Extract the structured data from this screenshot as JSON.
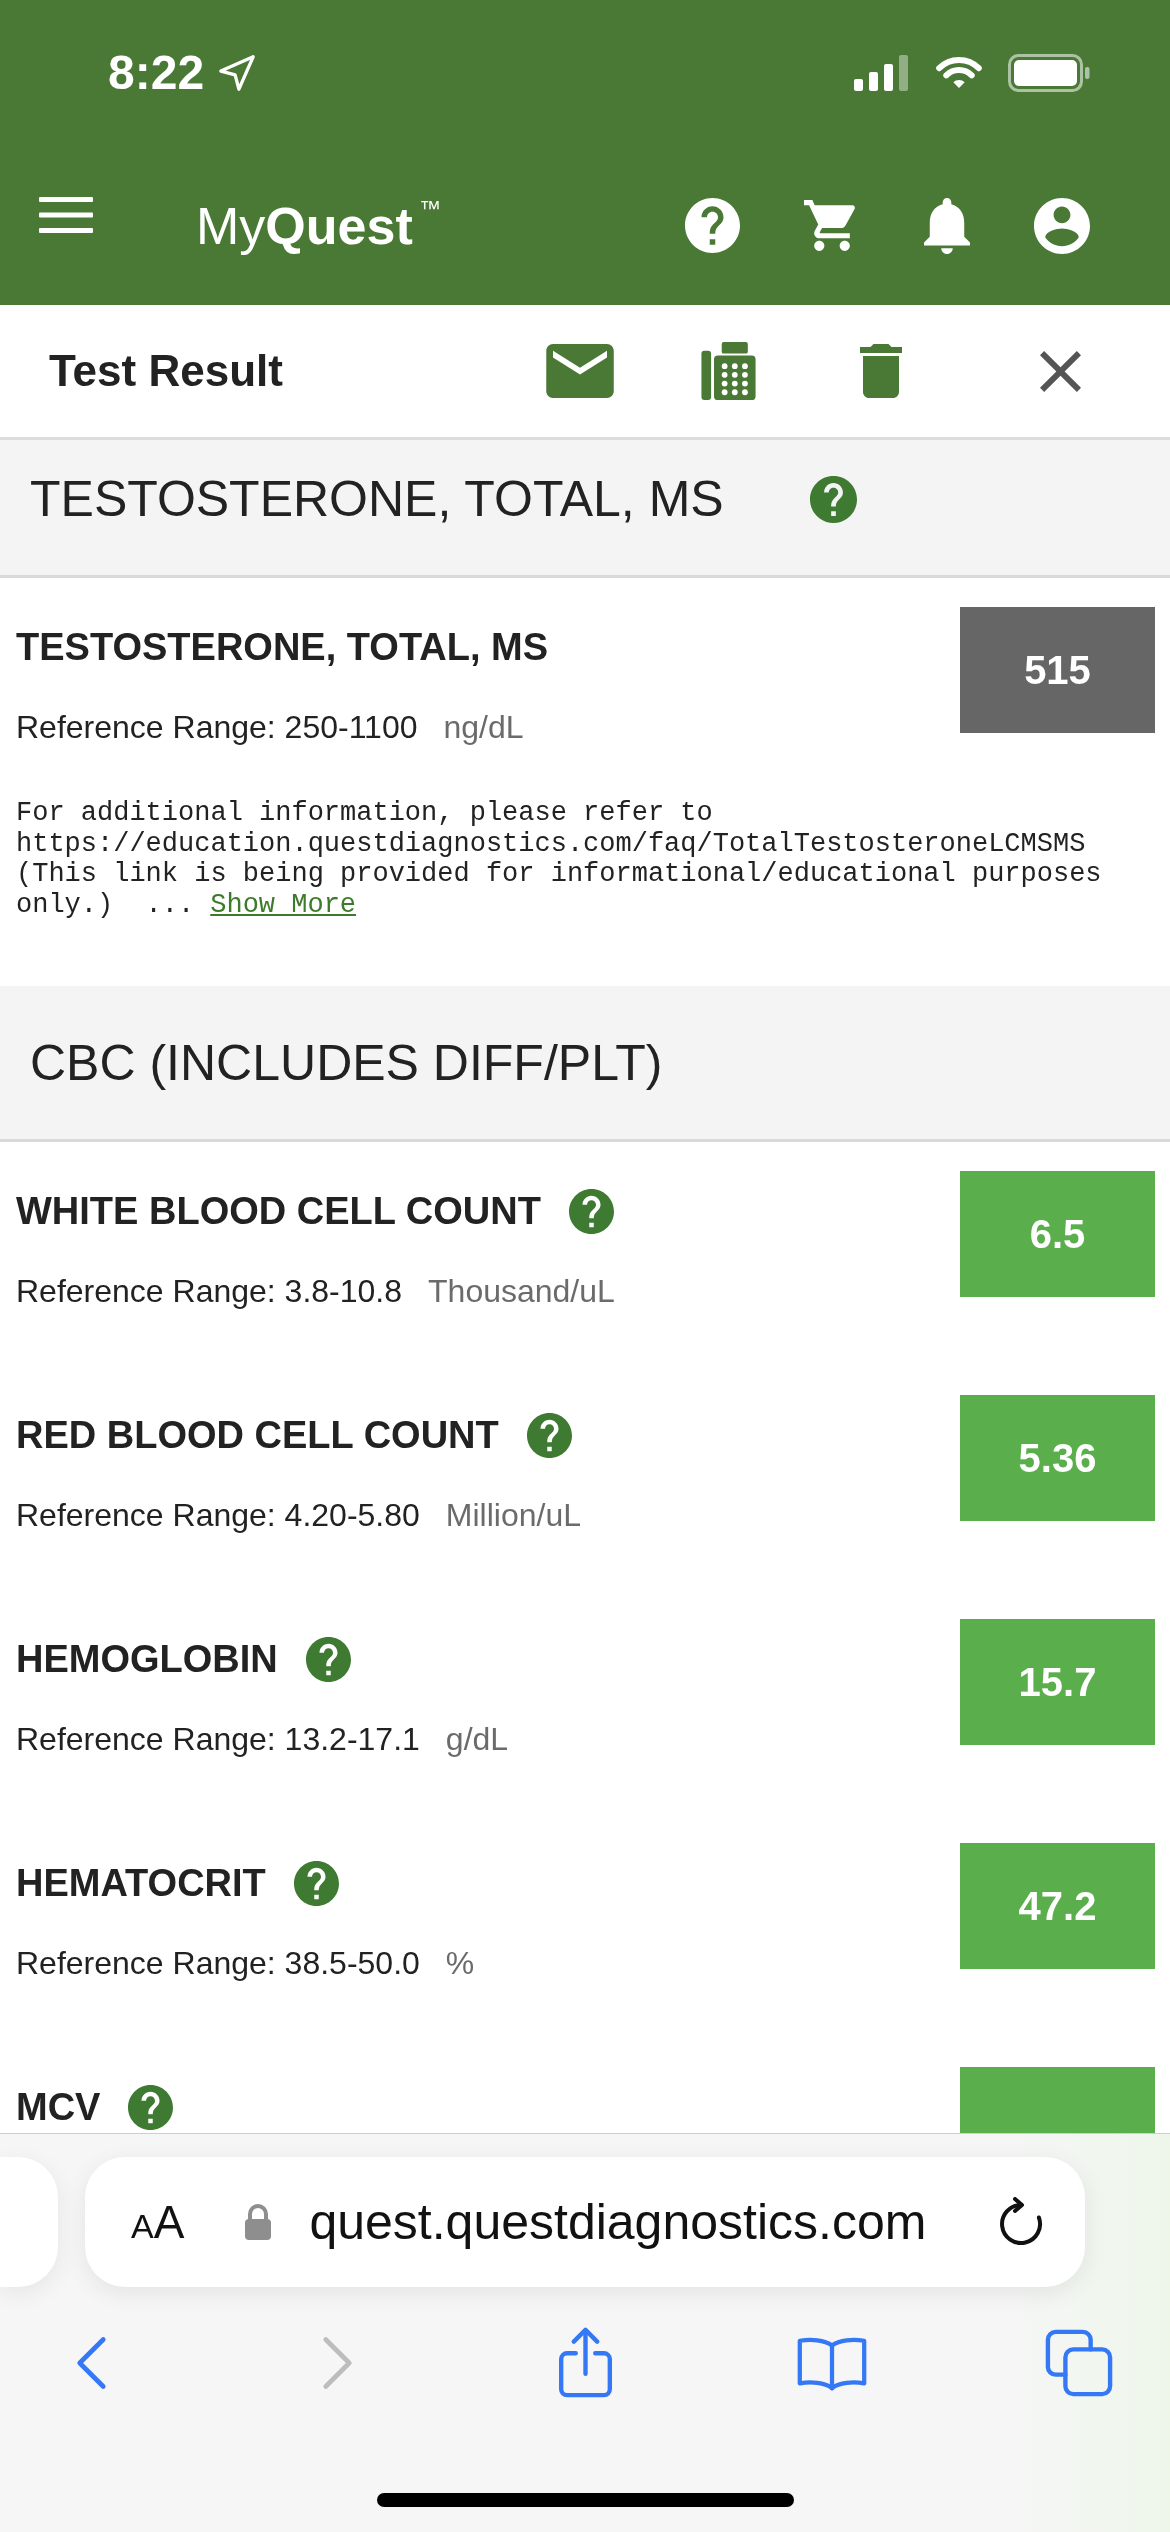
{
  "status_bar": {
    "time": "8:22"
  },
  "app_header": {
    "logo": "My**Quest**$^{™}$"
  },
  "toolbar": {
    "title": "Test Result"
  },
  "sections": [
    {
      "title": "TESTOSTERONE, TOTAL, MS",
      "help": true,
      "results": [
        {
          "name": "TESTOSTERONE, TOTAL, MS",
          "help": false,
          "range": "Reference Range: 250-1100",
          "unit": "ng/dL",
          "value": "515",
          "color": "#666666",
          "note": "For additional information, please refer to\nhttps://education.questdiagnostics.com/faq/TotalTestosteroneLCMSMS\n(This link is being provided for informational/educational purposes\nonly.)  ...",
          "note_link": "Show More"
        }
      ]
    },
    {
      "title": "CBC (INCLUDES DIFF/PLT)",
      "help": false,
      "results": [
        {
          "name": "WHITE BLOOD CELL COUNT",
          "help": true,
          "range": "Reference Range: 3.8-10.8",
          "unit": "Thousand/uL",
          "value": "6.5",
          "color": "#5aae4b"
        },
        {
          "name": "RED BLOOD CELL COUNT",
          "help": true,
          "range": "Reference Range: 4.20-5.80",
          "unit": "Million/uL",
          "value": "5.36",
          "color": "#5aae4b"
        },
        {
          "name": "HEMOGLOBIN",
          "help": true,
          "range": "Reference Range: 13.2-17.1",
          "unit": "g/dL",
          "value": "15.7",
          "color": "#5aae4b"
        },
        {
          "name": "HEMATOCRIT",
          "help": true,
          "range": "Reference Range: 38.5-50.0",
          "unit": "%",
          "value": "47.2",
          "color": "#5aae4b"
        },
        {
          "name": "MCV",
          "help": true,
          "color": "#5aae4b"
        }
      ]
    }
  ],
  "browser": {
    "text_size_button": {
      "small": "A",
      "large": "A"
    },
    "url": "quest.questdiagnostics.com",
    "nav_buttons": [
      {
        "kind": "back",
        "disabled": false
      },
      {
        "kind": "forward",
        "disabled": true
      },
      {
        "kind": "share",
        "disabled": false
      },
      {
        "kind": "bookmarks",
        "disabled": false
      },
      {
        "kind": "tabs",
        "disabled": false
      }
    ]
  }
}
